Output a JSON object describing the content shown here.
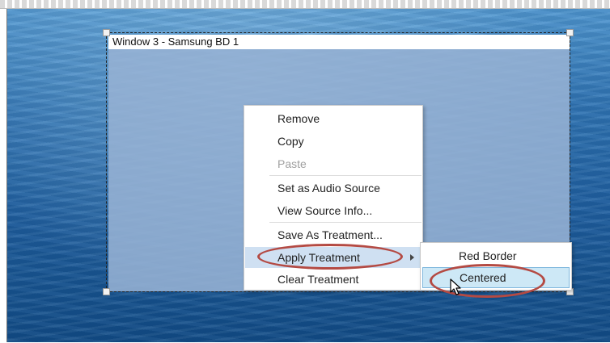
{
  "source_window": {
    "title": "Window 3 - Samsung BD 1"
  },
  "context_menu": {
    "items": [
      {
        "label": "Remove",
        "enabled": true
      },
      {
        "label": "Copy",
        "enabled": true
      },
      {
        "label": "Paste",
        "enabled": false
      },
      {
        "label": "Set as Audio Source",
        "enabled": true
      },
      {
        "label": "View Source Info...",
        "enabled": true
      },
      {
        "label": "Save As Treatment...",
        "enabled": true
      },
      {
        "label": "Apply Treatment",
        "enabled": true,
        "has_submenu": true,
        "active": true
      },
      {
        "label": "Clear Treatment",
        "enabled": true
      }
    ]
  },
  "submenu": {
    "items": [
      {
        "label": "Red Border"
      },
      {
        "label": "Centered",
        "hovered": true
      }
    ]
  },
  "colors": {
    "highlight_ring": "#b44a43",
    "menu_active": "#cfe0f2",
    "submenu_hover": "#cde8f6"
  }
}
